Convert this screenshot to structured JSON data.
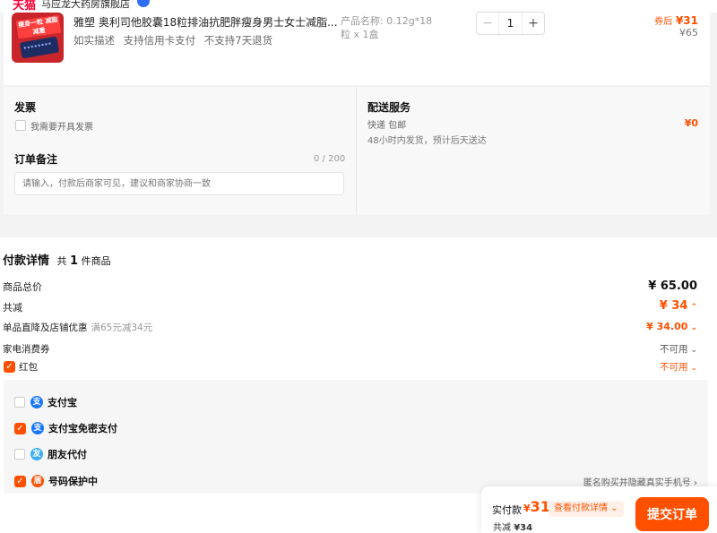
{
  "shop": {
    "logo_text": "天猫",
    "name": "马应龙大药房旗舰店"
  },
  "product": {
    "title": "雅塑 奥利司他胶囊18粒排油抗肥胖瘦身男士女士减脂...",
    "tags": "如实描述 支持信用卡支付 不支持7天退货",
    "spec_name": "产品名称: 0.12g*18",
    "spec_unit": "粒 x 1盒",
    "thumb_text": "瘦身一粒 减脂减重",
    "quantity": "1",
    "minus": "−",
    "plus": "+",
    "after_coupon_label": "券后",
    "after_coupon_price": "¥31",
    "original_price": "¥65"
  },
  "invoice": {
    "heading": "发票",
    "checkbox_label": "我需要开具发票"
  },
  "note": {
    "heading": "订单备注",
    "counter": "0 / 200",
    "placeholder": "请输入，付款后商家可见，建议和商家协商一致"
  },
  "delivery": {
    "heading": "配送服务",
    "type": "快递 包邮",
    "desc": "48小时内发货，预计后天送达",
    "fee": "¥0"
  },
  "payment": {
    "heading": "付款详情",
    "count_prefix": "共",
    "count": "1",
    "count_suffix": "件商品",
    "total_label": "商品总价",
    "total_value": "¥ 65.00",
    "reduce_label": "共减",
    "reduce_value": "¥ 34",
    "direct_label": "单品直降及店铺优惠",
    "direct_sub": "满65元减34元",
    "direct_value": "¥ 34.00",
    "coupon_label": "家电消费券",
    "coupon_value": "不可用",
    "hongbao_label": "红包",
    "hongbao_value": "不可用",
    "hongbao_checked": true
  },
  "methods": [
    {
      "label": "支付宝",
      "checked": false,
      "icon": "alipay-icon"
    },
    {
      "label": "支付宝免密支付",
      "checked": true,
      "icon": "alipay-icon"
    },
    {
      "label": "朋友代付",
      "checked": false,
      "icon": "friend-icon"
    },
    {
      "label": "号码保护中",
      "checked": true,
      "icon": "shield-icon"
    }
  ],
  "methods_hint": "匿名购买并隐藏真实手机号",
  "footer": {
    "actual_label": "实付款",
    "currency": "¥",
    "actual_value": "31",
    "detail_link": "查看付款详情",
    "reduce_label": "共减",
    "reduce_value": "¥34",
    "submit": "提交订单"
  },
  "colors": {
    "accent": "#ff5000",
    "tmall_red": "#ff0036",
    "alipay_blue": "#1677ff"
  }
}
